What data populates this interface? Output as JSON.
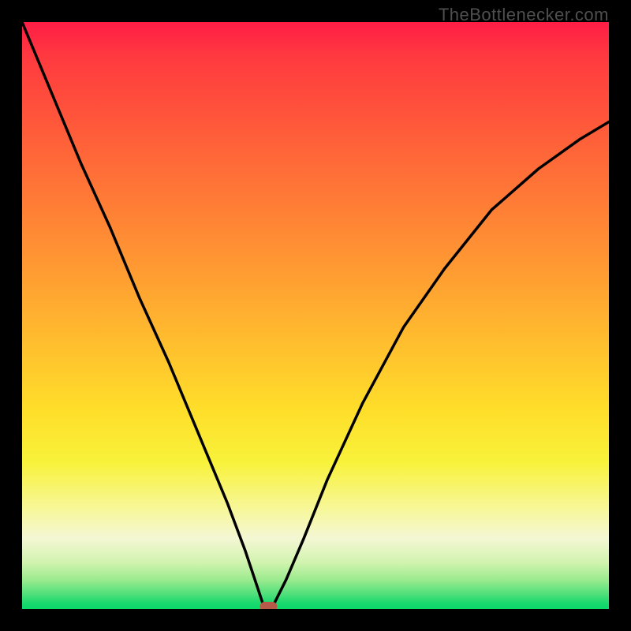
{
  "watermark": {
    "text": "TheBottlenecker.com"
  },
  "chart_data": {
    "type": "line",
    "title": "",
    "xlabel": "",
    "ylabel": "",
    "xlim": [
      0,
      100
    ],
    "ylim": [
      0,
      100
    ],
    "grid": false,
    "legend": false,
    "series": [
      {
        "name": "bottleneck-curve",
        "description": "V-shaped bottleneck curve reaching minimum near x≈42; background gradient encodes severity (red=high, green=low).",
        "x": [
          0,
          5,
          10,
          15,
          20,
          25,
          30,
          35,
          38,
          40,
          41,
          42,
          43,
          45,
          48,
          52,
          58,
          65,
          72,
          80,
          88,
          95,
          100
        ],
        "values": [
          100,
          88,
          76,
          65,
          53,
          42,
          30,
          18,
          10,
          4,
          1,
          0,
          1,
          5,
          12,
          22,
          35,
          48,
          58,
          68,
          75,
          80,
          83
        ]
      }
    ],
    "marker": {
      "name": "optimal-point",
      "x": 42,
      "y": 0,
      "color": "#b85a4a"
    },
    "background_gradient": {
      "stops": [
        {
          "pos": 0.0,
          "color": "#ff1d46"
        },
        {
          "pos": 0.5,
          "color": "#ffbc2e"
        },
        {
          "pos": 0.8,
          "color": "#f7f79a"
        },
        {
          "pos": 1.0,
          "color": "#0cd86a"
        }
      ]
    }
  }
}
